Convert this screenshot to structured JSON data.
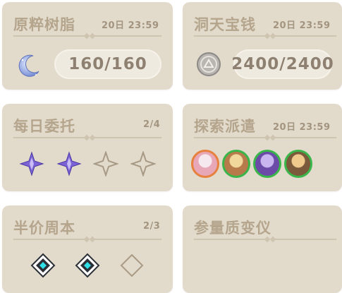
{
  "resin": {
    "title": "原粹树脂",
    "time": "20日 23:59",
    "value": "160/160",
    "icon": "moon-crescent-icon"
  },
  "realm": {
    "title": "洞天宝钱",
    "time": "20日 23:59",
    "value": "2400/2400",
    "icon": "coin-icon"
  },
  "commissions": {
    "title": "每日委托",
    "count": "2/4",
    "completed": 2,
    "total": 4
  },
  "expeditions": {
    "title": "探索派遣",
    "time": "20日 23:59",
    "characters": [
      {
        "icon": "character-avatar-icon",
        "ring": "#e6813e"
      },
      {
        "icon": "character-avatar-icon",
        "ring": "#39b54a"
      },
      {
        "icon": "character-avatar-icon",
        "ring": "#39b54a"
      },
      {
        "icon": "character-avatar-icon",
        "ring": "#39b54a"
      }
    ]
  },
  "weekly": {
    "title": "半价周本",
    "count": "2/3",
    "completed": 2,
    "total": 3
  },
  "transformer": {
    "title": "参量质变仪"
  },
  "colors": {
    "card": "#e2dbcc",
    "text": "#b5a58d",
    "accent": "#7d5fd6"
  }
}
